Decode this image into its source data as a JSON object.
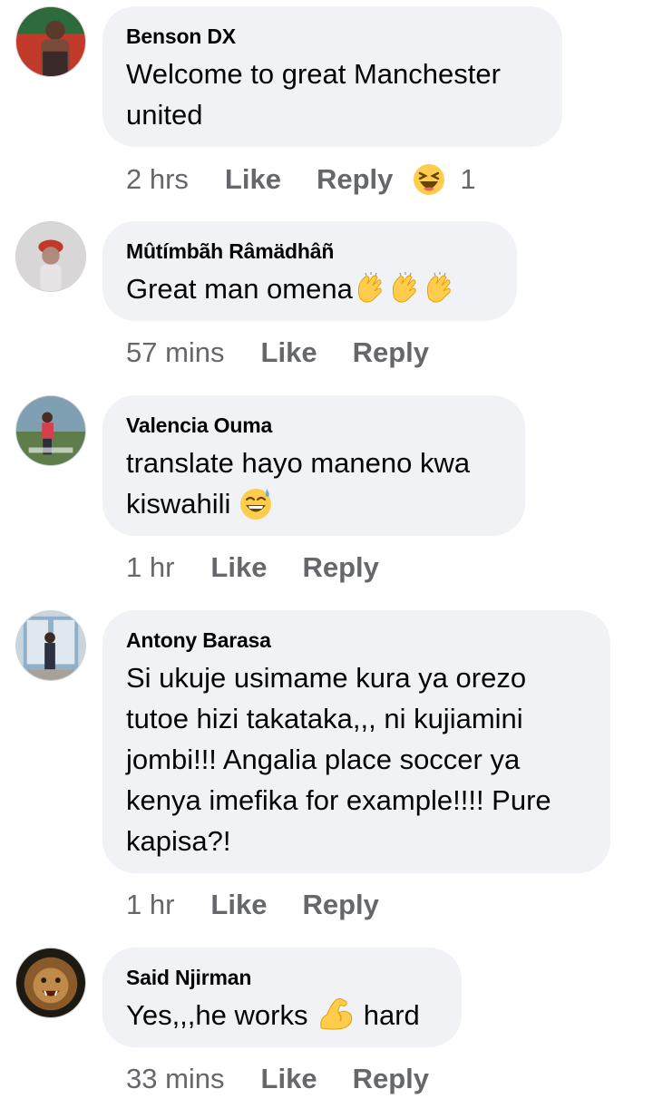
{
  "comments": [
    {
      "author": "Benson DX",
      "text_lines": [
        "Welcome to great Manchester",
        "united"
      ],
      "time": "2 hrs",
      "like_label": "Like",
      "reply_label": "Reply",
      "reaction": {
        "icon": "laughing-face-icon",
        "count": "1"
      }
    },
    {
      "author": "Mûtímbãh Râmädhâñ",
      "text": "Great man omena",
      "emojis": [
        "clapping-hands-icon",
        "clapping-hands-icon",
        "clapping-hands-icon"
      ],
      "time": "57 mins",
      "like_label": "Like",
      "reply_label": "Reply"
    },
    {
      "author": "Valencia Ouma",
      "text_lines": [
        "translate hayo maneno kwa",
        "kiswahili"
      ],
      "emojis": [
        "grinning-sweat-face-icon"
      ],
      "time": "1 hr",
      "like_label": "Like",
      "reply_label": "Reply"
    },
    {
      "author": "Antony Barasa",
      "text_lines": [
        "Si ukuje usimame kura ya orezo",
        "tutoe hizi takataka,,, ni kujiamini",
        "jombi!!! Angalia place soccer ya",
        "kenya imefika for example!!!! Pure",
        "kapisa?!"
      ],
      "time": "1 hr",
      "like_label": "Like",
      "reply_label": "Reply"
    },
    {
      "author": "Said Njirman",
      "text_before": "Yes,,,he works",
      "text_after": "hard",
      "emojis": [
        "flexed-biceps-icon"
      ],
      "time": "33 mins",
      "like_label": "Like",
      "reply_label": "Reply"
    }
  ],
  "colors": {
    "bubble": "#f0f2f5",
    "text": "#050505",
    "meta": "#65676b",
    "emoji_yellow": "#ffcc4d"
  }
}
